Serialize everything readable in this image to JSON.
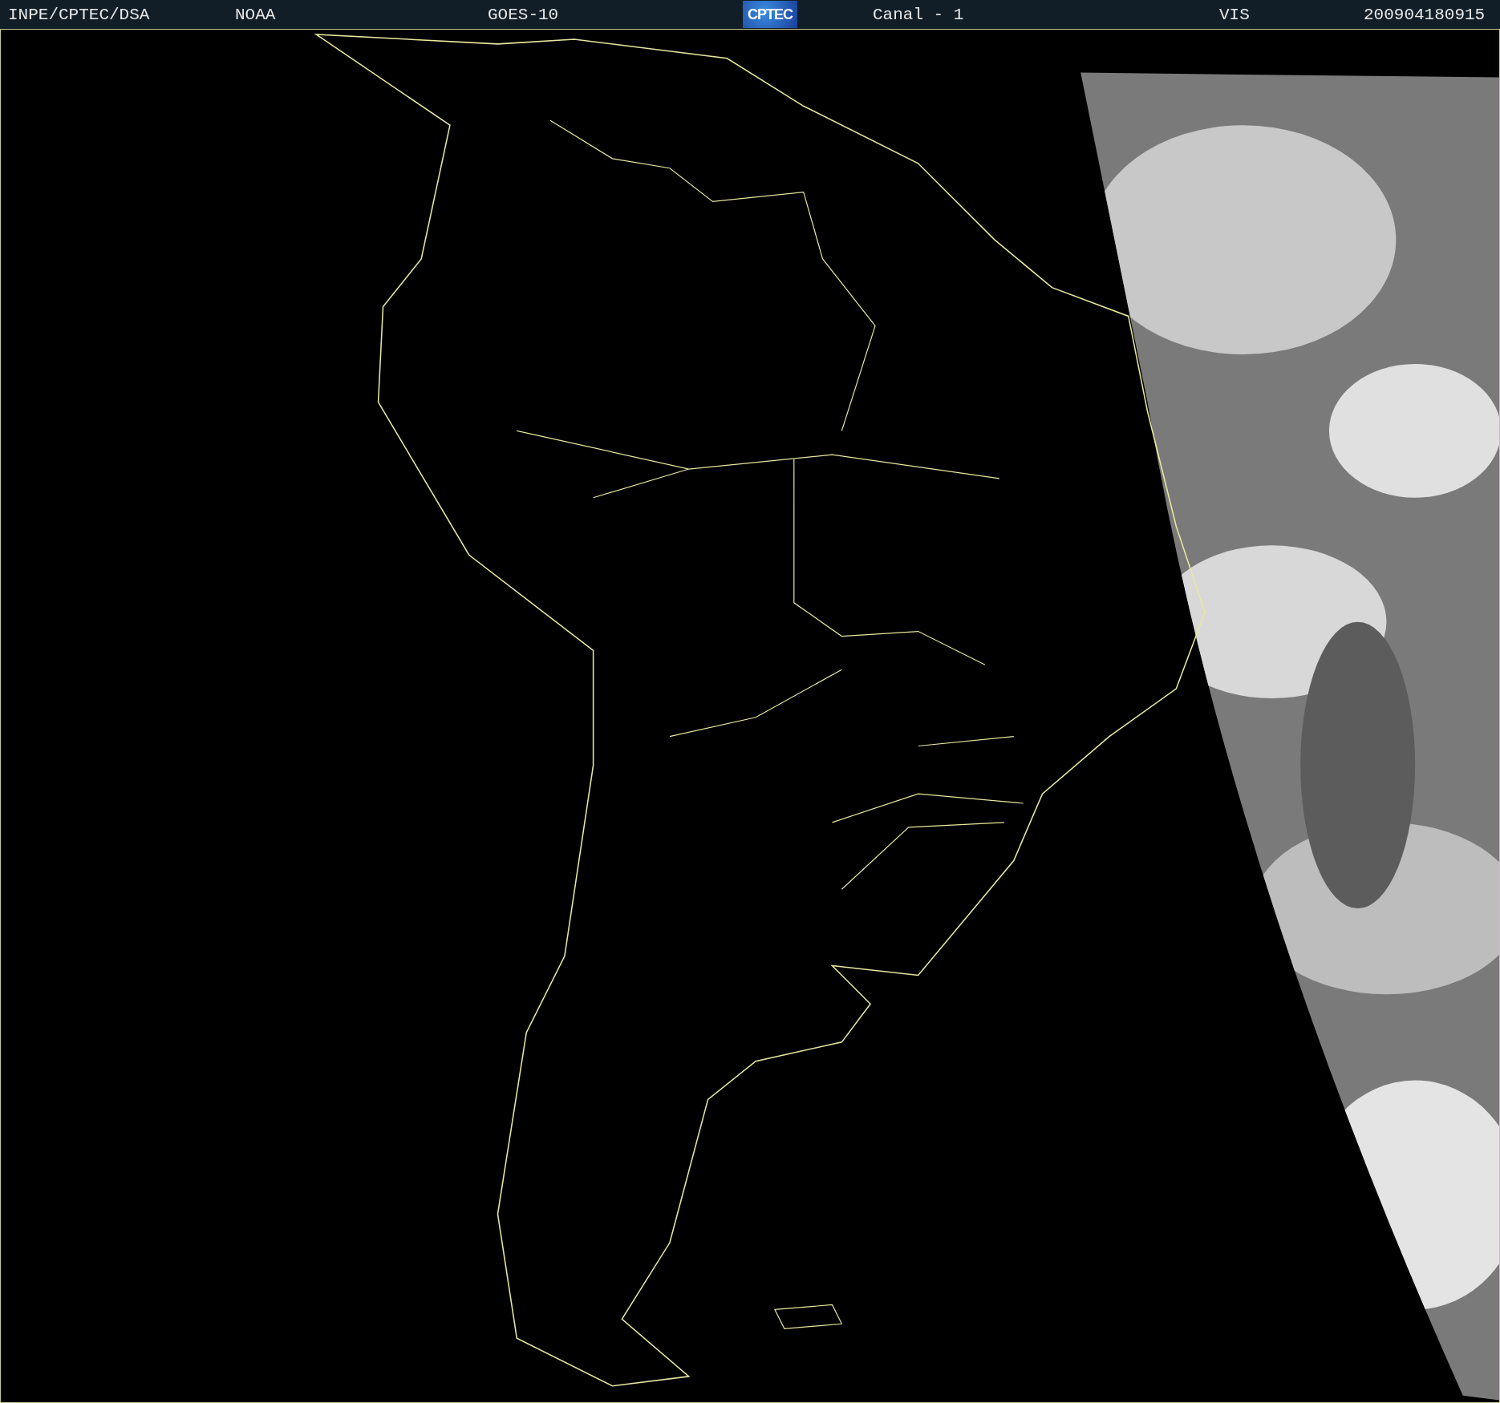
{
  "header": {
    "items": [
      {
        "kind": "text",
        "text": "INPE/CPTEC/DSA"
      },
      {
        "kind": "text",
        "text": "NOAA"
      },
      {
        "kind": "text",
        "text": "GOES-10"
      },
      {
        "kind": "logo",
        "text": "CPTEC"
      },
      {
        "kind": "text",
        "text": "Canal - 1"
      },
      {
        "kind": "text",
        "text": "VIS"
      },
      {
        "kind": "text",
        "text": "200904180915"
      }
    ]
  }
}
